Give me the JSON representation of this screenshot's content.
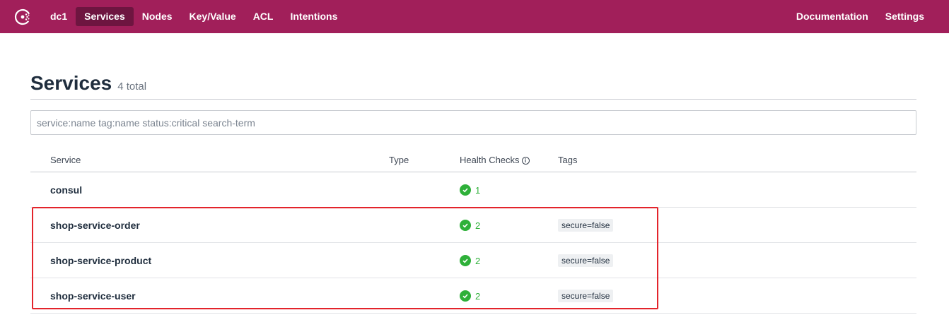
{
  "nav": {
    "datacenter": "dc1",
    "items": [
      "Services",
      "Nodes",
      "Key/Value",
      "ACL",
      "Intentions"
    ],
    "right_items": [
      "Documentation",
      "Settings"
    ],
    "active": "Services"
  },
  "page": {
    "title": "Services",
    "count": "4 total"
  },
  "search": {
    "placeholder": "service:name tag:name status:critical search-term"
  },
  "table": {
    "headers": [
      "Service",
      "Type",
      "Health Checks",
      "Tags"
    ],
    "rows": [
      {
        "name": "consul",
        "type": "",
        "checks": "1",
        "tag": ""
      },
      {
        "name": "shop-service-order",
        "type": "",
        "checks": "2",
        "tag": "secure=false"
      },
      {
        "name": "shop-service-product",
        "type": "",
        "checks": "2",
        "tag": "secure=false"
      },
      {
        "name": "shop-service-user",
        "type": "",
        "checks": "2",
        "tag": "secure=false"
      }
    ]
  },
  "colors": {
    "brand": "#a11f5a",
    "active_nav": "#6e1540",
    "passing": "#2eb039",
    "highlight": "#e3242b"
  }
}
